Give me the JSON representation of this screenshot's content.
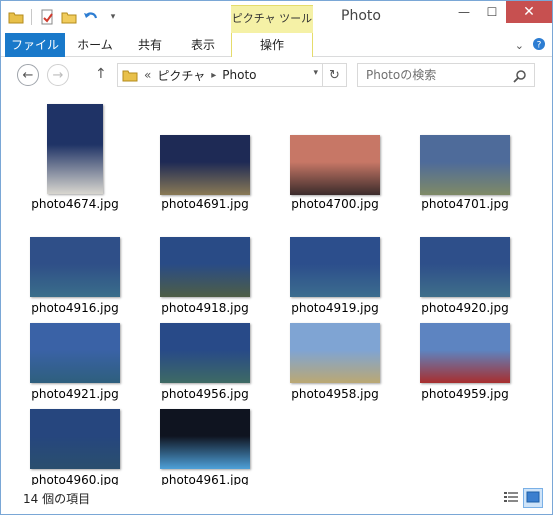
{
  "window": {
    "title": "Photo",
    "contextual_tab_group": "ピクチャ ツール",
    "controls": {
      "minimize": "—",
      "maximize": "☐",
      "close": "✕"
    }
  },
  "ribbon": {
    "tabs": [
      {
        "label": "ファイル",
        "active": true
      },
      {
        "label": "ホーム"
      },
      {
        "label": "共有"
      },
      {
        "label": "表示"
      },
      {
        "label": "操作"
      }
    ],
    "collapse_icon": "chevron-down-icon",
    "help_icon": "help-icon"
  },
  "nav": {
    "back_icon": "arrow-left-icon",
    "forward_icon": "arrow-right-icon",
    "up_icon": "arrow-up-icon",
    "breadcrumb": {
      "overflow": "«",
      "parts": [
        "ピクチャ",
        "Photo"
      ],
      "separator": "▸"
    },
    "refresh_icon": "refresh-icon",
    "search_placeholder": "Photoの検索"
  },
  "files": [
    {
      "name": "photo4674.jpg",
      "palette": [
        "#1f3366",
        "#d8d6cf"
      ],
      "orientation": "portrait"
    },
    {
      "name": "photo4691.jpg",
      "palette": [
        "#1e2a55",
        "#8a7a55"
      ]
    },
    {
      "name": "photo4700.jpg",
      "palette": [
        "#c77766",
        "#3b2b2b"
      ]
    },
    {
      "name": "photo4701.jpg",
      "palette": [
        "#4e6b9a",
        "#7f8a66"
      ]
    },
    {
      "name": "photo4916.jpg",
      "palette": [
        "#2f4f88",
        "#3a6e8a"
      ]
    },
    {
      "name": "photo4918.jpg",
      "palette": [
        "#294b86",
        "#4e5e45"
      ]
    },
    {
      "name": "photo4919.jpg",
      "palette": [
        "#2c4e8c",
        "#3c6d8e"
      ]
    },
    {
      "name": "photo4920.jpg",
      "palette": [
        "#2e4f8a",
        "#3f6f8a"
      ]
    },
    {
      "name": "photo4921.jpg",
      "palette": [
        "#3a62a6",
        "#2e5f7d"
      ]
    },
    {
      "name": "photo4956.jpg",
      "palette": [
        "#284a88",
        "#3e6a64"
      ]
    },
    {
      "name": "photo4958.jpg",
      "palette": [
        "#7fa4d3",
        "#bba873"
      ]
    },
    {
      "name": "photo4959.jpg",
      "palette": [
        "#5d84c1",
        "#a82e2e"
      ]
    },
    {
      "name": "photo4960.jpg",
      "palette": [
        "#26467e",
        "#2a4f6e"
      ]
    },
    {
      "name": "photo4961.jpg",
      "palette": [
        "#0f1420",
        "#4ea0d8"
      ]
    }
  ],
  "status": {
    "item_count": "14 個の項目",
    "view_details_icon": "details-view-icon",
    "view_icons_icon": "large-icons-view-icon"
  },
  "colors": {
    "ribbon_file_tab": "#1979ca",
    "contextual_tab": "#f5f1a6",
    "close_button": "#c75050",
    "selected_view": "#cfe4f9"
  }
}
